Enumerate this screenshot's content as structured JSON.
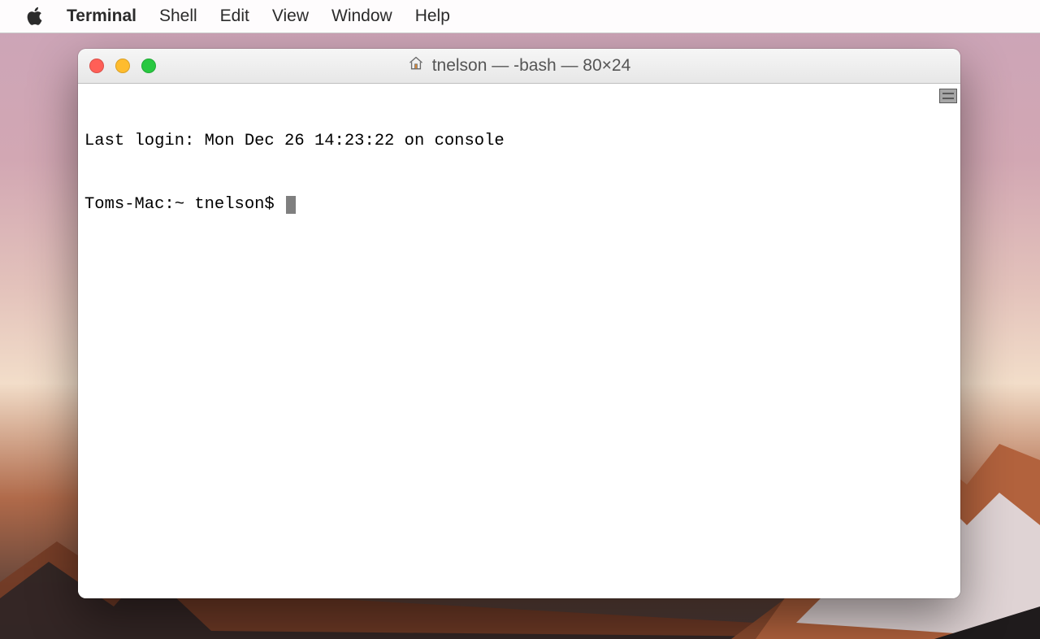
{
  "menubar": {
    "app_name": "Terminal",
    "items": [
      "Shell",
      "Edit",
      "View",
      "Window",
      "Help"
    ]
  },
  "window": {
    "title": "tnelson — -bash — 80×24",
    "home_icon": "home-icon"
  },
  "terminal": {
    "last_login_line": "Last login: Mon Dec 26 14:23:22 on console",
    "prompt": "Toms-Mac:~ tnelson$ "
  }
}
